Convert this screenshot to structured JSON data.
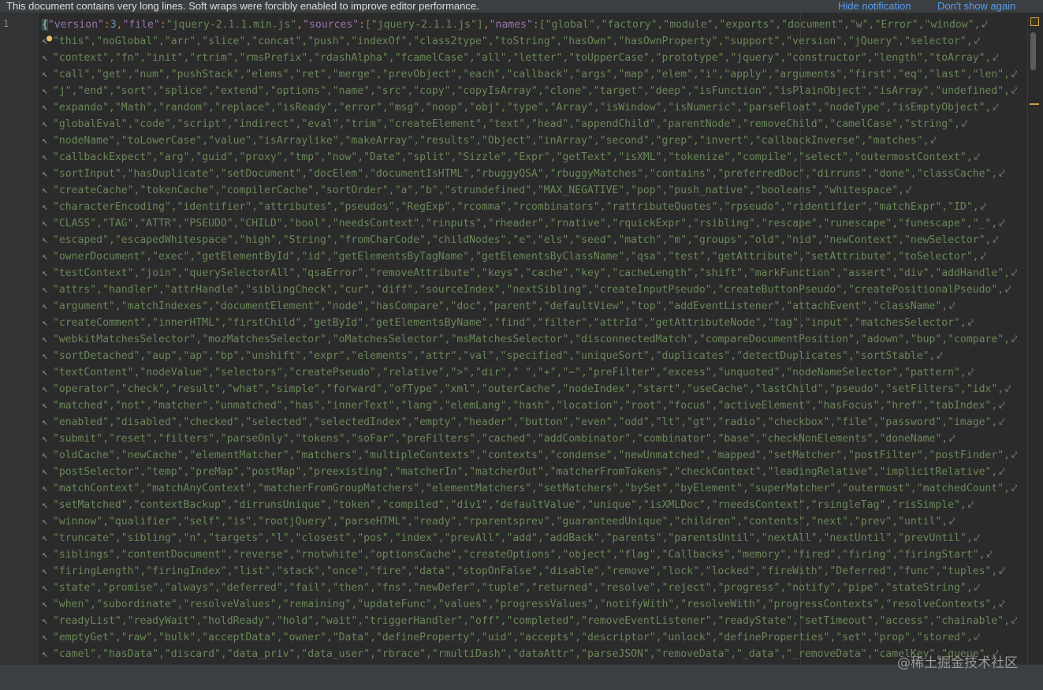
{
  "notification": {
    "message": "This document contains very long lines. Soft wraps were forcibly enabled to improve editor performance.",
    "hide_label": "Hide notification",
    "dont_show_label": "Don't show again"
  },
  "gutter": {
    "line_number": "1"
  },
  "editor": {
    "first_line": {
      "open_brace": "{",
      "version_key": "\"version\"",
      "version_value": "3",
      "file_key": "\"file\"",
      "file_value": "\"jquery-2.1.1.min.js\"",
      "sources_key": "\"sources\"",
      "sources_value": "[\"jquery-2.1.1.js\"]",
      "names_key": "\"names\"",
      "names_start": "[\"global\",\"factory\",\"module\",\"exports\",\"document\",\"w\",\"Error\",\"window\","
    },
    "wrapped_lines": [
      "\"this\",\"noGlobal\",\"arr\",\"slice\",\"concat\",\"push\",\"indexOf\",\"class2type\",\"toString\",\"hasOwn\",\"hasOwnProperty\",\"support\",\"version\",\"jQuery\",\"selector\",",
      "\"context\",\"fn\",\"init\",\"rtrim\",\"rmsPrefix\",\"rdashAlpha\",\"fcamelCase\",\"all\",\"letter\",\"toUpperCase\",\"prototype\",\"jquery\",\"constructor\",\"length\",\"toArray\",",
      "\"call\",\"get\",\"num\",\"pushStack\",\"elems\",\"ret\",\"merge\",\"prevObject\",\"each\",\"callback\",\"args\",\"map\",\"elem\",\"i\",\"apply\",\"arguments\",\"first\",\"eq\",\"last\",\"len\",",
      "\"j\",\"end\",\"sort\",\"splice\",\"extend\",\"options\",\"name\",\"src\",\"copy\",\"copyIsArray\",\"clone\",\"target\",\"deep\",\"isFunction\",\"isPlainObject\",\"isArray\",\"undefined\",",
      "\"expando\",\"Math\",\"random\",\"replace\",\"isReady\",\"error\",\"msg\",\"noop\",\"obj\",\"type\",\"Array\",\"isWindow\",\"isNumeric\",\"parseFloat\",\"nodeType\",\"isEmptyObject\",",
      "\"globalEval\",\"code\",\"script\",\"indirect\",\"eval\",\"trim\",\"createElement\",\"text\",\"head\",\"appendChild\",\"parentNode\",\"removeChild\",\"camelCase\",\"string\",",
      "\"nodeName\",\"toLowerCase\",\"value\",\"isArraylike\",\"makeArray\",\"results\",\"Object\",\"inArray\",\"second\",\"grep\",\"invert\",\"callbackInverse\",\"matches\",",
      "\"callbackExpect\",\"arg\",\"guid\",\"proxy\",\"tmp\",\"now\",\"Date\",\"split\",\"Sizzle\",\"Expr\",\"getText\",\"isXML\",\"tokenize\",\"compile\",\"select\",\"outermostContext\",",
      "\"sortInput\",\"hasDuplicate\",\"setDocument\",\"docElem\",\"documentIsHTML\",\"rbuggyQSA\",\"rbuggyMatches\",\"contains\",\"preferredDoc\",\"dirruns\",\"done\",\"classCache\",",
      "\"createCache\",\"tokenCache\",\"compilerCache\",\"sortOrder\",\"a\",\"b\",\"strundefined\",\"MAX_NEGATIVE\",\"pop\",\"push_native\",\"booleans\",\"whitespace\",",
      "\"characterEncoding\",\"identifier\",\"attributes\",\"pseudos\",\"RegExp\",\"rcomma\",\"rcombinators\",\"rattributeQuotes\",\"rpseudo\",\"ridentifier\",\"matchExpr\",\"ID\",",
      "\"CLASS\",\"TAG\",\"ATTR\",\"PSEUDO\",\"CHILD\",\"bool\",\"needsContext\",\"rinputs\",\"rheader\",\"rnative\",\"rquickExpr\",\"rsibling\",\"rescape\",\"runescape\",\"funescape\",\"_\",",
      "\"escaped\",\"escapedWhitespace\",\"high\",\"String\",\"fromCharCode\",\"childNodes\",\"e\",\"els\",\"seed\",\"match\",\"m\",\"groups\",\"old\",\"nid\",\"newContext\",\"newSelector\",",
      "\"ownerDocument\",\"exec\",\"getElementById\",\"id\",\"getElementsByTagName\",\"getElementsByClassName\",\"qsa\",\"test\",\"getAttribute\",\"setAttribute\",\"toSelector\",",
      "\"testContext\",\"join\",\"querySelectorAll\",\"qsaError\",\"removeAttribute\",\"keys\",\"cache\",\"key\",\"cacheLength\",\"shift\",\"markFunction\",\"assert\",\"div\",\"addHandle\",",
      "\"attrs\",\"handler\",\"attrHandle\",\"siblingCheck\",\"cur\",\"diff\",\"sourceIndex\",\"nextSibling\",\"createInputPseudo\",\"createButtonPseudo\",\"createPositionalPseudo\",",
      "\"argument\",\"matchIndexes\",\"documentElement\",\"node\",\"hasCompare\",\"doc\",\"parent\",\"defaultView\",\"top\",\"addEventListener\",\"attachEvent\",\"className\",",
      "\"createComment\",\"innerHTML\",\"firstChild\",\"getById\",\"getElementsByName\",\"find\",\"filter\",\"attrId\",\"getAttributeNode\",\"tag\",\"input\",\"matchesSelector\",",
      "\"webkitMatchesSelector\",\"mozMatchesSelector\",\"oMatchesSelector\",\"msMatchesSelector\",\"disconnectedMatch\",\"compareDocumentPosition\",\"adown\",\"bup\",\"compare\",",
      "\"sortDetached\",\"aup\",\"ap\",\"bp\",\"unshift\",\"expr\",\"elements\",\"attr\",\"val\",\"specified\",\"uniqueSort\",\"duplicates\",\"detectDuplicates\",\"sortStable\",",
      "\"textContent\",\"nodeValue\",\"selectors\",\"createPseudo\",\"relative\",\">\",\"dir\",\" \",\"+\",\"~\",\"preFilter\",\"excess\",\"unquoted\",\"nodeNameSelector\",\"pattern\",",
      "\"operator\",\"check\",\"result\",\"what\",\"simple\",\"forward\",\"ofType\",\"xml\",\"outerCache\",\"nodeIndex\",\"start\",\"useCache\",\"lastChild\",\"pseudo\",\"setFilters\",\"idx\",",
      "\"matched\",\"not\",\"matcher\",\"unmatched\",\"has\",\"innerText\",\"lang\",\"elemLang\",\"hash\",\"location\",\"root\",\"focus\",\"activeElement\",\"hasFocus\",\"href\",\"tabIndex\",",
      "\"enabled\",\"disabled\",\"checked\",\"selected\",\"selectedIndex\",\"empty\",\"header\",\"button\",\"even\",\"odd\",\"lt\",\"gt\",\"radio\",\"checkbox\",\"file\",\"password\",\"image\",",
      "\"submit\",\"reset\",\"filters\",\"parseOnly\",\"tokens\",\"soFar\",\"preFilters\",\"cached\",\"addCombinator\",\"combinator\",\"base\",\"checkNonElements\",\"doneName\",",
      "\"oldCache\",\"newCache\",\"elementMatcher\",\"matchers\",\"multipleContexts\",\"contexts\",\"condense\",\"newUnmatched\",\"mapped\",\"setMatcher\",\"postFilter\",\"postFinder\",",
      "\"postSelector\",\"temp\",\"preMap\",\"postMap\",\"preexisting\",\"matcherIn\",\"matcherOut\",\"matcherFromTokens\",\"checkContext\",\"leadingRelative\",\"implicitRelative\",",
      "\"matchContext\",\"matchAnyContext\",\"matcherFromGroupMatchers\",\"elementMatchers\",\"setMatchers\",\"bySet\",\"byElement\",\"superMatcher\",\"outermost\",\"matchedCount\",",
      "\"setMatched\",\"contextBackup\",\"dirrunsUnique\",\"token\",\"compiled\",\"div1\",\"defaultValue\",\"unique\",\"isXMLDoc\",\"rneedsContext\",\"rsingleTag\",\"risSimple\",",
      "\"winnow\",\"qualifier\",\"self\",\"is\",\"rootjQuery\",\"parseHTML\",\"ready\",\"rparentsprev\",\"guaranteedUnique\",\"children\",\"contents\",\"next\",\"prev\",\"until\",",
      "\"truncate\",\"sibling\",\"n\",\"targets\",\"l\",\"closest\",\"pos\",\"index\",\"prevAll\",\"add\",\"addBack\",\"parents\",\"parentsUntil\",\"nextAll\",\"nextUntil\",\"prevUntil\",",
      "\"siblings\",\"contentDocument\",\"reverse\",\"rnotwhite\",\"optionsCache\",\"createOptions\",\"object\",\"flag\",\"Callbacks\",\"memory\",\"fired\",\"firing\",\"firingStart\",",
      "\"firingLength\",\"firingIndex\",\"list\",\"stack\",\"once\",\"fire\",\"data\",\"stopOnFalse\",\"disable\",\"remove\",\"lock\",\"locked\",\"fireWith\",\"Deferred\",\"func\",\"tuples\",",
      "\"state\",\"promise\",\"always\",\"deferred\",\"fail\",\"then\",\"fns\",\"newDefer\",\"tuple\",\"returned\",\"resolve\",\"reject\",\"progress\",\"notify\",\"pipe\",\"stateString\",",
      "\"when\",\"subordinate\",\"resolveValues\",\"remaining\",\"updateFunc\",\"values\",\"progressValues\",\"notifyWith\",\"resolveWith\",\"progressContexts\",\"resolveContexts\",",
      "\"readyList\",\"readyWait\",\"holdReady\",\"hold\",\"wait\",\"triggerHandler\",\"off\",\"completed\",\"removeEventListener\",\"readyState\",\"setTimeout\",\"access\",\"chainable\",",
      "\"emptyGet\",\"raw\",\"bulk\",\"acceptData\",\"owner\",\"Data\",\"defineProperty\",\"uid\",\"accepts\",\"descriptor\",\"unlock\",\"defineProperties\",\"set\",\"prop\",\"stored\",",
      "\"camel\",\"hasData\",\"discard\",\"data_priv\",\"data_user\",\"rbrace\",\"rmultiDash\",\"dataAttr\",\"parseJSON\",\"removeData\",\"_data\",\"_removeData\",\"camelKey\",\"queue\","
    ]
  },
  "watermark": "@稀土掘金技术社区",
  "colors": {
    "background": "#2b2b2b",
    "string": "#6a8759",
    "key": "#9876aa",
    "number": "#6897bb",
    "link": "#589df6"
  }
}
